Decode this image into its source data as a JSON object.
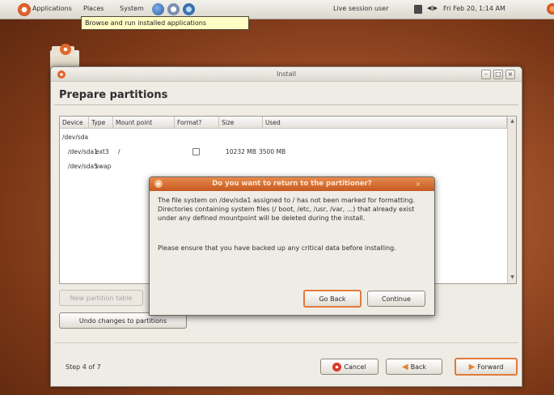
{
  "panel": {
    "applications": "Applications",
    "places": "Places",
    "system": "System",
    "user": "Live session user",
    "datetime": "Fri Feb 20,  1:14 AM"
  },
  "tooltip": "Browse and run installed applications",
  "window": {
    "title": "Install",
    "heading": "Prepare partitions",
    "columns": [
      "Device",
      "Type",
      "Mount point",
      "Format?",
      "Size",
      "Used"
    ],
    "rows": [
      {
        "device": "/dev/sda",
        "type": "",
        "mount": "",
        "format": false,
        "size": "",
        "used": ""
      },
      {
        "device": "/dev/sda1",
        "type": "ext3",
        "mount": "/",
        "format": false,
        "size": "10232 MB",
        "used": "3500 MB"
      },
      {
        "device": "/dev/sda5",
        "type": "swap",
        "mount": "",
        "format": false,
        "size": "",
        "used": ""
      }
    ],
    "new_table_label": "New partition table",
    "undo_label": "Undo changes to partitions",
    "step": "Step 4 of 7",
    "cancel_label": "Cancel",
    "back_label": "Back",
    "forward_label": "Forward"
  },
  "dialog": {
    "title": "Do you want to return to the partitioner?",
    "paragraph1": "The file system on /dev/sda1 assigned to / has not been marked for formatting. Directories containing system files (/ boot, /etc, /usr, /var, ...) that already exist under any defined mountpoint will be deleted during the install.",
    "paragraph2": "Please ensure that you have backed up any critical data before installing.",
    "go_back_label": "Go Back",
    "continue_label": "Continue"
  }
}
